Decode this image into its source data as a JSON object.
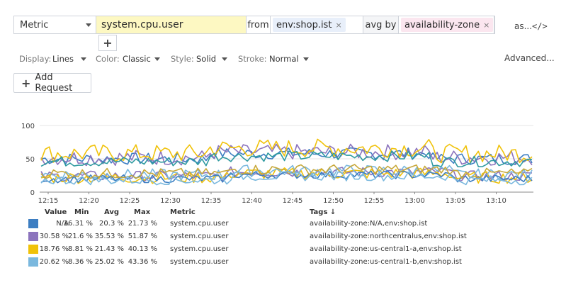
{
  "query": {
    "metric_type": "Metric",
    "metric_name": "system.cpu.user",
    "from_label": "from",
    "scope_tag": "env:shop.ist",
    "aggregator": "avg by",
    "group_tag": "availability-zone",
    "tag_remove": "×",
    "as_label": "as...",
    "code_label": "</>",
    "add_query": "+"
  },
  "display_options": {
    "display_label": "Display:",
    "display_value": "Lines",
    "color_label": "Color:",
    "color_value": "Classic",
    "style_label": "Style:",
    "style_value": "Solid",
    "stroke_label": "Stroke:",
    "stroke_value": "Normal",
    "advanced": "Advanced..."
  },
  "add_request": {
    "icon": "+",
    "label": "Add Request"
  },
  "chart_data": {
    "type": "line",
    "y_ticks": [
      "100",
      "50",
      "0"
    ],
    "ylim": [
      0,
      100
    ],
    "x_ticks": [
      "12:15",
      "12:20",
      "12:25",
      "12:30",
      "12:35",
      "12:40",
      "12:45",
      "12:50",
      "12:55",
      "13:00",
      "13:05",
      "13:10"
    ],
    "grid": "horizontal",
    "series_colors": [
      "#3d7ec2",
      "#8c74bd",
      "#f0c20a",
      "#7ab8de",
      "#2f9aa0",
      "#c7a83a"
    ]
  },
  "legend": {
    "headers": {
      "value": "Value",
      "min": "Min",
      "avg": "Avg",
      "max": "Max",
      "metric": "Metric",
      "tags": "Tags ↓"
    },
    "rows": [
      {
        "color": "#3d7ec2",
        "value": "N/A",
        "min": "16.31 %",
        "avg": "20.3 %",
        "max": "21.73 %",
        "metric": "system.cpu.user",
        "tags": "availability-zone:N/A,env:shop.ist"
      },
      {
        "color": "#8c74bd",
        "value": "30.58 %",
        "min": "21.6 %",
        "avg": "35.53 %",
        "max": "51.87 %",
        "metric": "system.cpu.user",
        "tags": "availability-zone:northcentralus,env:shop.ist"
      },
      {
        "color": "#f0c20a",
        "value": "18.76 %",
        "min": "8.81 %",
        "avg": "21.43 %",
        "max": "40.13 %",
        "metric": "system.cpu.user",
        "tags": "availability-zone:us-central1-a,env:shop.ist"
      },
      {
        "color": "#7ab8de",
        "value": "20.62 %",
        "min": "8.36 %",
        "avg": "25.02 %",
        "max": "43.36 %",
        "metric": "system.cpu.user",
        "tags": "availability-zone:us-central1-b,env:shop.ist"
      }
    ]
  }
}
